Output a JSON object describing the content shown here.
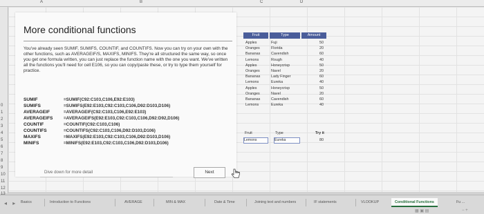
{
  "column_headers": [
    "A",
    "B",
    "C",
    "D"
  ],
  "row_numbers": [
    "0",
    "1",
    "2",
    "3",
    "4",
    "5",
    "6",
    "7",
    "8",
    "9",
    "10",
    "11",
    "12",
    "13"
  ],
  "card": {
    "title": "More conditional functions",
    "intro": "You've already seen SUMIF, SUMIFS, COUNTIF, and COUNTIFS. Now you can try on your own with the other functions, such as AVERAGEIF/S, MAXIFS, MINIFS. They're all structured the same way, so once you get one formula written, you can just replace the function name with the one you want. We've written all the functions you'll need for cell E106, so you can copy/paste these, or try to type them yourself for practice.",
    "functions": [
      {
        "name": "SUMIF",
        "formula": "=SUMIF(C92:C103,C106,E92:E103)"
      },
      {
        "name": "SUMIFS",
        "formula": "=SUMIFS(E92:E103,C92:C103,C106,D92:D103,D106)"
      },
      {
        "name": "AVERAGEIF",
        "formula": "=AVERAGEIF(C92:C103,C106,E92:E103)"
      },
      {
        "name": "AVERAGEIFS",
        "formula": "=AVERAGEIFS(E92:E103,C92:C103,C106,D92:D92,D106)"
      },
      {
        "name": "COUNTIF",
        "formula": "=COUNTIF(C92:C103,C106)"
      },
      {
        "name": "COUNTIFS",
        "formula": "=COUNTIFS(C92:C103,C106,D92:D103,D106)"
      },
      {
        "name": "MAXIFS",
        "formula": "=MAXIFS(E92:E103,C92:C103,C106,D92:D103,D106)"
      },
      {
        "name": "MINIFS",
        "formula": "=MINIFS(E92:E103,C92:C103,C106,D92:D103,D106)"
      }
    ],
    "tip": "Dive down for more detail",
    "next_label": "Next"
  },
  "table": {
    "headers": [
      "Fruit",
      "Type",
      "Amount"
    ],
    "rows": [
      [
        "Apples",
        "Fuji",
        "50"
      ],
      [
        "Oranges",
        "Florida",
        "20"
      ],
      [
        "Bananas",
        "Cavendish",
        "60"
      ],
      [
        "Lemons",
        "Rough",
        "40"
      ],
      [
        "Apples",
        "Honeycrisp",
        "50"
      ],
      [
        "Oranges",
        "Navel",
        "20"
      ],
      [
        "Bananas",
        "Lady Finger",
        "60"
      ],
      [
        "Lemons",
        "Eureka",
        "40"
      ],
      [
        "Apples",
        "Honeycrisp",
        "50"
      ],
      [
        "Oranges",
        "Navel",
        "20"
      ],
      [
        "Bananas",
        "Cavendish",
        "60"
      ],
      [
        "Lemons",
        "Eureka",
        "40"
      ]
    ]
  },
  "tryit": {
    "fruit_label": "Fruit",
    "type_label": "Type",
    "tryit_label": "Try it",
    "fruit_value": "Lemons",
    "type_value": "Eureka",
    "result": "80"
  },
  "tabs": [
    {
      "label": "Basics",
      "active": false
    },
    {
      "label": "Introduction to Functions",
      "active": false
    },
    {
      "label": "AVERAGE",
      "active": false
    },
    {
      "label": "MIN & MAX",
      "active": false
    },
    {
      "label": "Date & Time",
      "active": false
    },
    {
      "label": "Joining text and numbers",
      "active": false
    },
    {
      "label": "IF statements",
      "active": false
    },
    {
      "label": "VLOOKUP",
      "active": false
    },
    {
      "label": "Conditional Functions",
      "active": true
    },
    {
      "label": "Fu ...",
      "active": false
    }
  ],
  "colors": {
    "table_header": "#4a5d9a",
    "active_tab": "#256f3c"
  }
}
